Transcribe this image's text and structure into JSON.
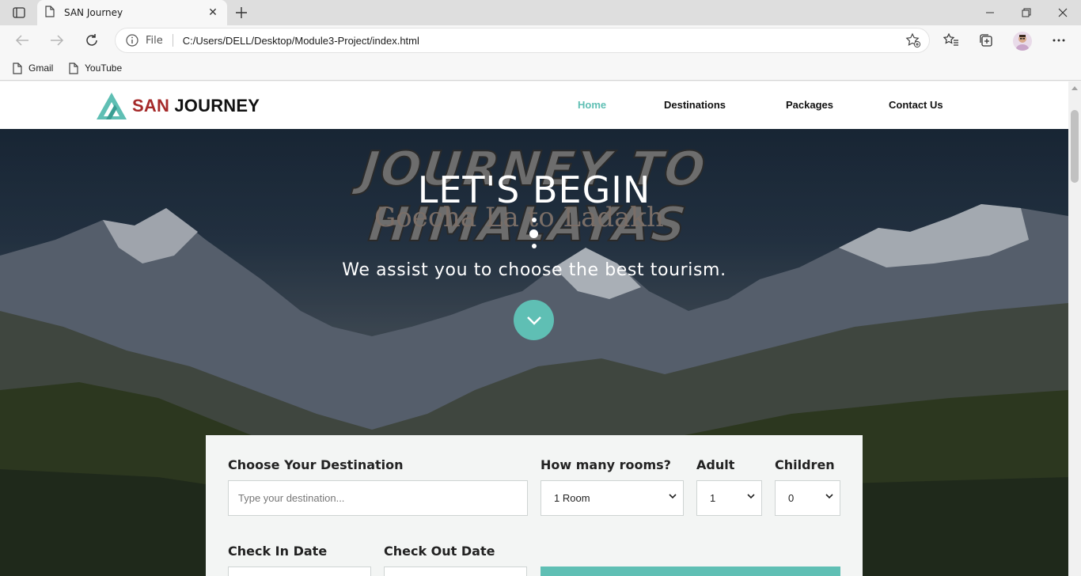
{
  "browser": {
    "tab_title": "SAN Journey",
    "address_scheme_label": "File",
    "url": "C:/Users/DELL/Desktop/Module3-Project/index.html",
    "bookmarks": [
      {
        "label": "Gmail"
      },
      {
        "label": "YouTube"
      }
    ]
  },
  "site": {
    "logo": {
      "part1": "SAN",
      "part2": "JOURNEY"
    },
    "nav": [
      {
        "label": "Home",
        "active": true
      },
      {
        "label": "Destinations"
      },
      {
        "label": "Packages"
      },
      {
        "label": "Contact Us"
      }
    ],
    "hero": {
      "banner_title": "JOURNEY TO HIMALAYAS",
      "banner_subtitle": "Goecha La to Ladakh",
      "title": "LET'S BEGIN",
      "tagline": "We assist you to choose the best tourism."
    },
    "booking": {
      "destination_label": "Choose Your Destination",
      "destination_placeholder": "Type your destination...",
      "rooms_label": "How many rooms?",
      "rooms_value": "1 Room",
      "adult_label": "Adult",
      "adult_value": "1",
      "children_label": "Children",
      "children_value": "0",
      "checkin_label": "Check In Date",
      "checkout_label": "Check Out Date"
    }
  },
  "colors": {
    "accent": "#5fbfb4",
    "brand_red": "#a52a2a"
  }
}
